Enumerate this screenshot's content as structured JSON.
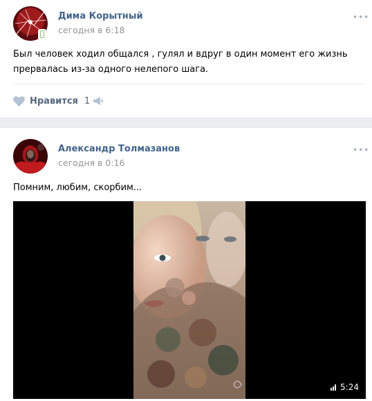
{
  "posts": [
    {
      "author": "Дима Корытный",
      "time": "сегодня в 6:18",
      "text": "Был человек ходил общался , гулял и вдруг в один момент его жизнь прервалась из-за одного нелепого шага.",
      "like_label": "Нравится",
      "like_count": "1",
      "more": "•••"
    },
    {
      "author": "Александр Толмазанов",
      "time": "сегодня в 0:16",
      "text": "Помним, любим, скорбим...",
      "video_duration": "5:24",
      "more": "•••"
    }
  ],
  "colors": {
    "author": "#42648b",
    "meta": "#939393",
    "action": "#55677d",
    "separator": "#edeef0"
  }
}
